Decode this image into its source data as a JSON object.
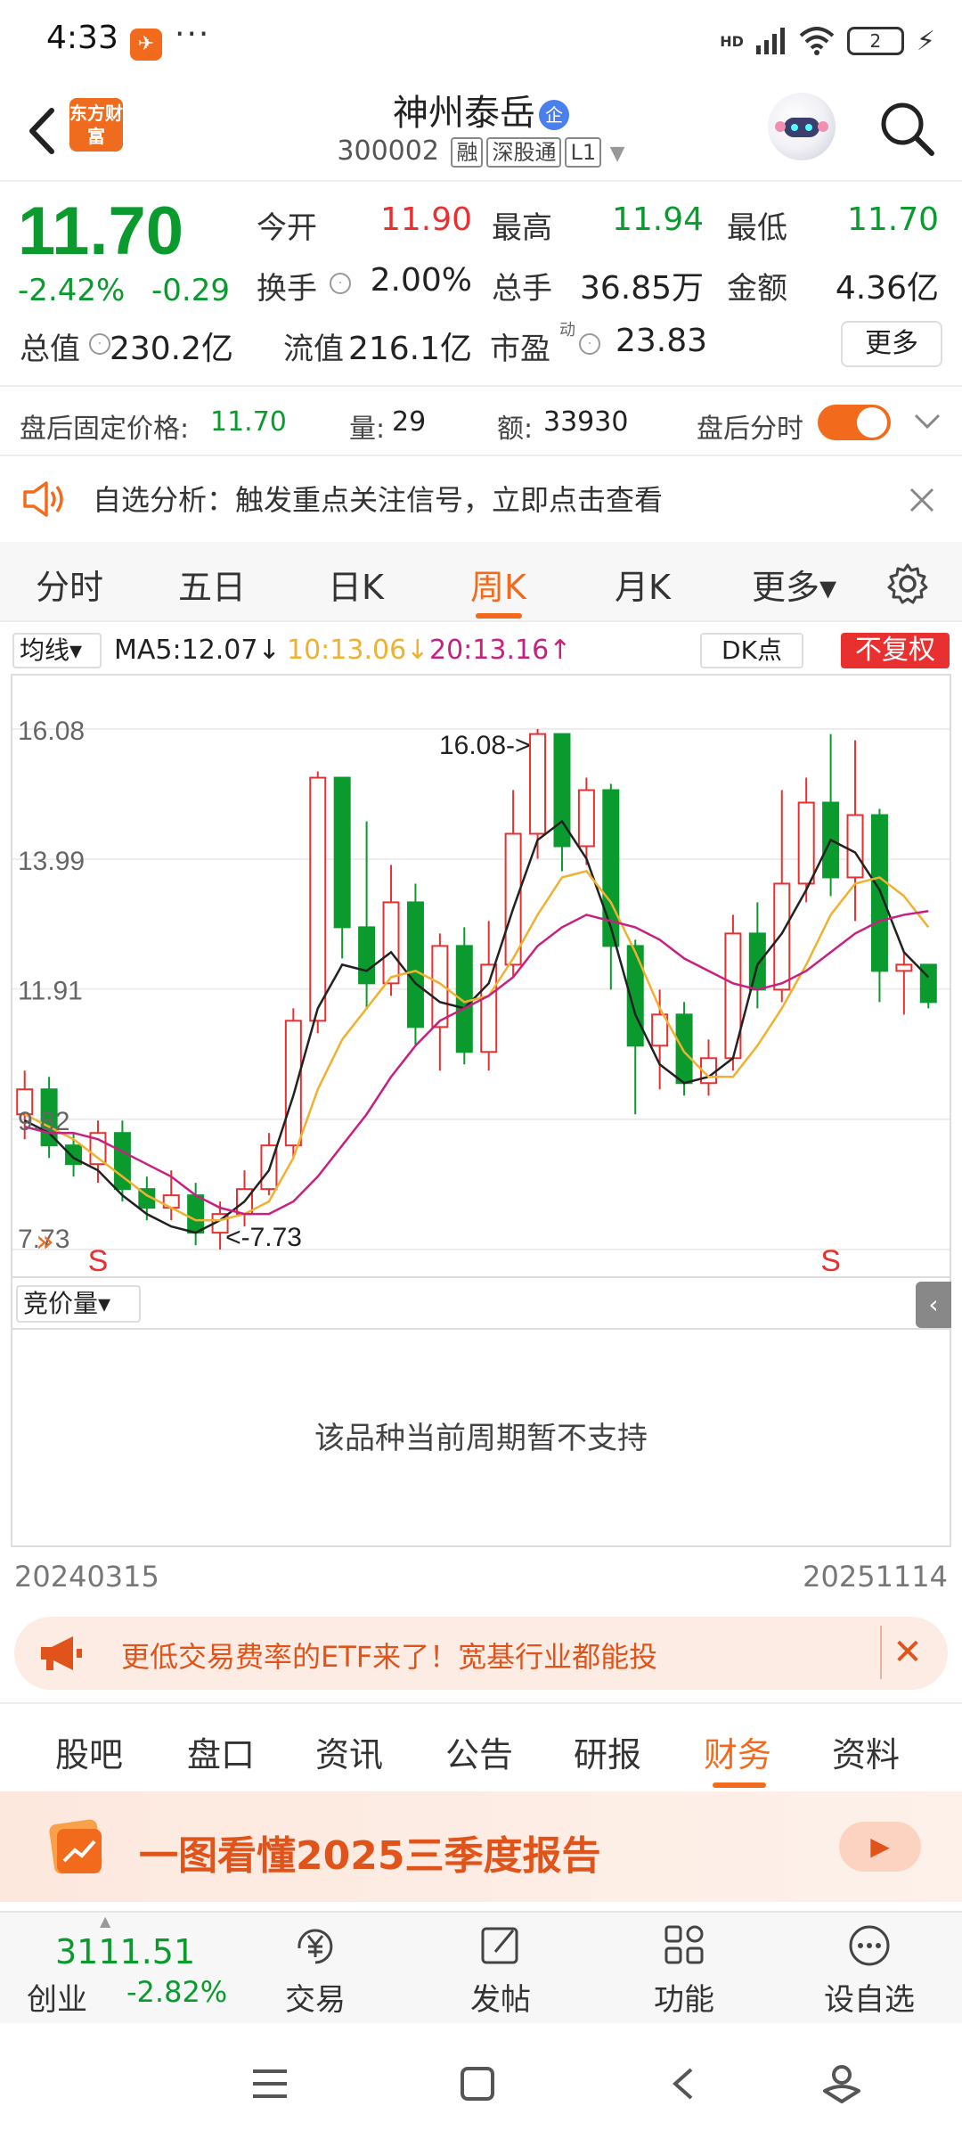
{
  "status_bar": {
    "time": "4:33",
    "more": "···",
    "network": "HD",
    "battery": "2"
  },
  "header": {
    "logo_text": "东方财富",
    "stock_name": "神州泰岳",
    "enterprise_badge": "企",
    "stock_code": "300002",
    "tags": [
      "融",
      "深股通",
      "L1"
    ]
  },
  "quote": {
    "price": "11.70",
    "change_pct": "-2.42%",
    "change_abs": "-0.29",
    "rows": [
      [
        {
          "label": "今开",
          "value": "11.90",
          "color": "#e93030"
        },
        {
          "label": "最高",
          "value": "11.94",
          "color": "#0a9a2e"
        },
        {
          "label": "最低",
          "value": "11.70",
          "color": "#0a9a2e"
        }
      ],
      [
        {
          "label": "换手",
          "value": "2.00%",
          "color": "#222222"
        },
        {
          "label": "总手",
          "value": "36.85万",
          "color": "#222222"
        },
        {
          "label": "金额",
          "value": "4.36亿",
          "color": "#222222"
        }
      ],
      [
        {
          "label": "总值",
          "value": "230.2亿",
          "color": "#222222"
        },
        {
          "label": "流值",
          "value": "216.1亿",
          "color": "#222222"
        },
        {
          "label": "市盈",
          "value": "23.83",
          "color": "#222222"
        }
      ]
    ],
    "pe_superscript": "动",
    "more_label": "更多"
  },
  "after_hours": {
    "price_label": "盘后固定价格:",
    "price_value": "11.70",
    "volume_label": "量:",
    "volume_value": "29",
    "amount_label": "额:",
    "amount_value": "33930",
    "timeshare_label": "盘后分时"
  },
  "notice": {
    "text": "自选分析：触发重点关注信号，立即点击查看"
  },
  "chart_tabs": [
    {
      "label": "分时",
      "active": false
    },
    {
      "label": "五日",
      "active": false
    },
    {
      "label": "日K",
      "active": false
    },
    {
      "label": "周K",
      "active": true
    },
    {
      "label": "月K",
      "active": false
    },
    {
      "label": "更多▾",
      "active": false
    }
  ],
  "indicator": {
    "ma_select": "均线▾",
    "ma5": "MA5:12.07↓",
    "ma10": "10:13.06↓",
    "ma20": "20:13.16↑",
    "dk_label": "DK点",
    "fq_label": "不复权",
    "colors": {
      "ma5": "#222222",
      "ma10": "#f0b030",
      "ma20": "#c8207f"
    }
  },
  "chart_data": {
    "type": "candlestick",
    "y_ticks": [
      "16.08",
      "13.99",
      "11.91",
      "9.82",
      "7.73"
    ],
    "ylim": [
      7.73,
      16.08
    ],
    "high_annotation": "16.08->",
    "low_annotation": "<-7.73",
    "signals": [
      "S",
      "S"
    ],
    "x_start": "20240315",
    "x_end": "20251114",
    "series": [
      {
        "name": "MA5",
        "color": "#222222",
        "values": [
          9.8,
          9.6,
          9.2,
          9.0,
          8.6,
          8.3,
          8.1,
          8.0,
          8.2,
          8.5,
          9.0,
          10.2,
          11.6,
          12.3,
          12.2,
          12.5,
          12.0,
          11.7,
          11.6,
          12.0,
          13.2,
          14.3,
          14.6,
          14.0,
          12.9,
          11.5,
          10.7,
          10.4,
          10.5,
          10.8,
          12.3,
          12.8,
          13.5,
          14.3,
          14.1,
          13.5,
          12.5,
          12.1
        ]
      },
      {
        "name": "MA10",
        "color": "#f0b030",
        "values": [
          9.9,
          9.7,
          9.5,
          9.2,
          8.9,
          8.6,
          8.4,
          8.2,
          8.2,
          8.3,
          8.5,
          9.2,
          10.3,
          11.1,
          11.6,
          12.1,
          12.2,
          12.0,
          11.7,
          11.8,
          12.4,
          13.1,
          13.7,
          13.8,
          13.3,
          12.5,
          11.6,
          10.9,
          10.5,
          10.5,
          11.0,
          11.6,
          12.3,
          13.1,
          13.6,
          13.7,
          13.4,
          12.9
        ]
      },
      {
        "name": "MA20",
        "color": "#c8207f",
        "values": [
          9.7,
          9.6,
          9.6,
          9.5,
          9.3,
          9.1,
          8.9,
          8.6,
          8.4,
          8.3,
          8.3,
          8.5,
          8.9,
          9.4,
          9.9,
          10.5,
          11.0,
          11.4,
          11.6,
          11.8,
          12.1,
          12.6,
          12.9,
          13.1,
          13.0,
          12.9,
          12.7,
          12.4,
          12.2,
          12.0,
          11.9,
          12.0,
          12.2,
          12.5,
          12.8,
          13.0,
          13.1,
          13.16
        ]
      }
    ],
    "candles": [
      [
        9.9,
        10.3,
        9.5,
        10.6
      ],
      [
        10.3,
        9.4,
        9.2,
        10.5
      ],
      [
        9.4,
        9.1,
        8.9,
        9.6
      ],
      [
        9.1,
        9.6,
        8.8,
        9.8
      ],
      [
        9.6,
        8.7,
        8.5,
        9.8
      ],
      [
        8.7,
        8.4,
        8.2,
        8.9
      ],
      [
        8.4,
        8.6,
        8.2,
        9.0
      ],
      [
        8.6,
        8.0,
        7.8,
        8.8
      ],
      [
        8.0,
        8.3,
        7.73,
        8.5
      ],
      [
        8.3,
        8.7,
        8.1,
        9.0
      ],
      [
        8.7,
        9.4,
        8.6,
        9.6
      ],
      [
        9.4,
        11.4,
        9.2,
        11.6
      ],
      [
        11.4,
        15.3,
        11.2,
        15.4
      ],
      [
        15.3,
        12.9,
        12.4,
        14.0
      ],
      [
        12.9,
        12.0,
        11.6,
        14.6
      ],
      [
        12.0,
        13.3,
        11.8,
        13.9
      ],
      [
        13.3,
        11.3,
        11.0,
        13.6
      ],
      [
        11.3,
        12.6,
        10.6,
        12.8
      ],
      [
        12.6,
        10.9,
        10.7,
        12.9
      ],
      [
        10.9,
        12.3,
        10.6,
        13.0
      ],
      [
        12.3,
        14.4,
        12.1,
        15.1
      ],
      [
        14.4,
        16.0,
        14.0,
        16.08
      ],
      [
        16.0,
        14.2,
        13.8,
        16.0
      ],
      [
        14.2,
        15.1,
        13.9,
        15.3
      ],
      [
        15.1,
        12.6,
        11.9,
        15.2
      ],
      [
        12.6,
        11.0,
        9.9,
        12.7
      ],
      [
        11.0,
        11.5,
        10.3,
        11.9
      ],
      [
        11.5,
        10.4,
        10.2,
        11.7
      ],
      [
        10.4,
        10.8,
        10.2,
        11.1
      ],
      [
        10.8,
        12.8,
        10.6,
        13.1
      ],
      [
        12.8,
        11.9,
        11.6,
        13.3
      ],
      [
        11.9,
        13.6,
        11.7,
        15.1
      ],
      [
        13.6,
        14.9,
        13.3,
        15.3
      ],
      [
        14.9,
        13.7,
        13.4,
        16.0
      ],
      [
        13.7,
        14.7,
        13.0,
        15.9
      ],
      [
        14.7,
        12.2,
        11.7,
        14.8
      ],
      [
        12.2,
        12.3,
        11.5,
        12.5
      ],
      [
        12.3,
        11.7,
        11.6,
        12.3
      ]
    ]
  },
  "volume": {
    "select_label": "竞价量▾",
    "message": "该品种当前周期暂不支持"
  },
  "promo": {
    "text": "更低交易费率的ETF来了！宽基行业都能投"
  },
  "info_tabs": [
    {
      "label": "股吧",
      "active": false
    },
    {
      "label": "盘口",
      "active": false
    },
    {
      "label": "资讯",
      "active": false
    },
    {
      "label": "公告",
      "active": false
    },
    {
      "label": "研报",
      "active": false
    },
    {
      "label": "财务",
      "active": true
    },
    {
      "label": "资料",
      "active": false
    }
  ],
  "report_banner": {
    "text": "一图看懂2025三季度报告"
  },
  "bottom_bar": {
    "index_value": "3111.51",
    "index_name": "创业",
    "index_change": "-2.82%",
    "nav": [
      {
        "label": "交易",
        "icon": "yuan-cycle-icon"
      },
      {
        "label": "发帖",
        "icon": "edit-icon"
      },
      {
        "label": "功能",
        "icon": "grid-icon"
      },
      {
        "label": "设自选",
        "icon": "more-circle-icon"
      }
    ]
  }
}
